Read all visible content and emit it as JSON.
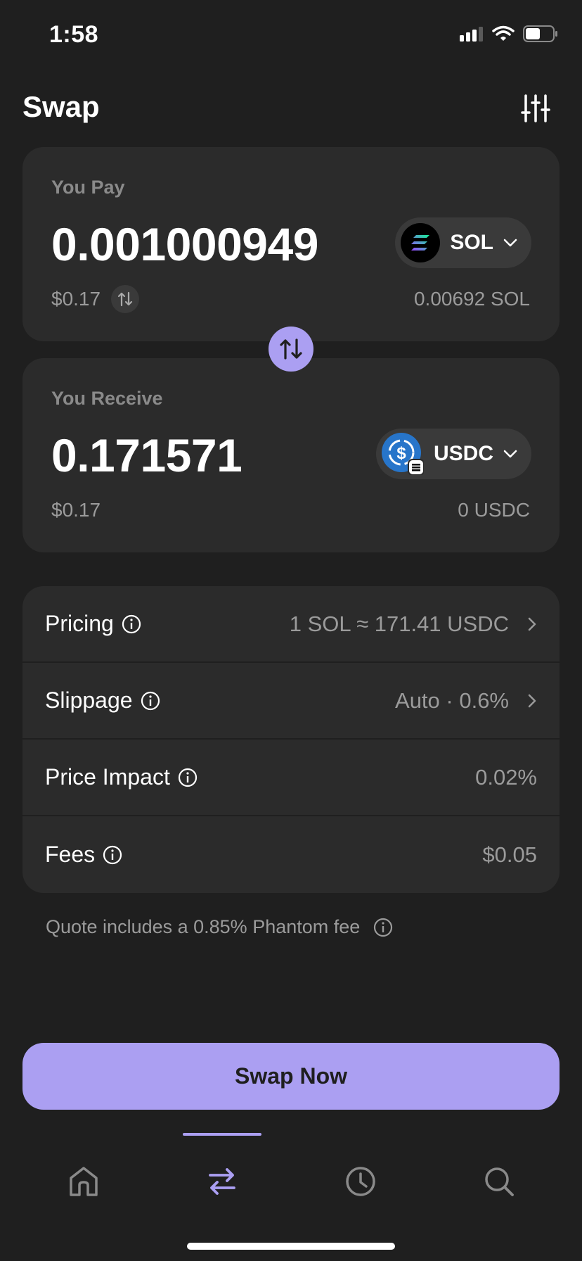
{
  "status_bar": {
    "time": "1:58"
  },
  "header": {
    "title": "Swap"
  },
  "pay": {
    "label": "You Pay",
    "amount": "0.001000949",
    "usd": "$0.17",
    "token": "SOL",
    "balance": "0.00692 SOL"
  },
  "receive": {
    "label": "You Receive",
    "amount": "0.171571",
    "usd": "$0.17",
    "token": "USDC",
    "balance": "0 USDC"
  },
  "details": [
    {
      "label": "Pricing",
      "value": "1 SOL ≈ 171.41 USDC",
      "has_chevron": true
    },
    {
      "label": "Slippage",
      "value": "Auto · 0.6%",
      "has_chevron": true
    },
    {
      "label": "Price Impact",
      "value": "0.02%",
      "has_chevron": false
    },
    {
      "label": "Fees",
      "value": "$0.05",
      "has_chevron": false
    }
  ],
  "fee_note": "Quote includes a 0.85% Phantom fee",
  "swap_button": "Swap Now",
  "tabs": [
    {
      "name": "home-icon",
      "active": false
    },
    {
      "name": "swap-icon",
      "active": true
    },
    {
      "name": "history-icon",
      "active": false
    },
    {
      "name": "search-icon",
      "active": false
    }
  ],
  "colors": {
    "accent": "#ab9ff2",
    "background": "#1f1f1f",
    "card": "#2b2b2b",
    "muted": "#9b9b9b"
  }
}
